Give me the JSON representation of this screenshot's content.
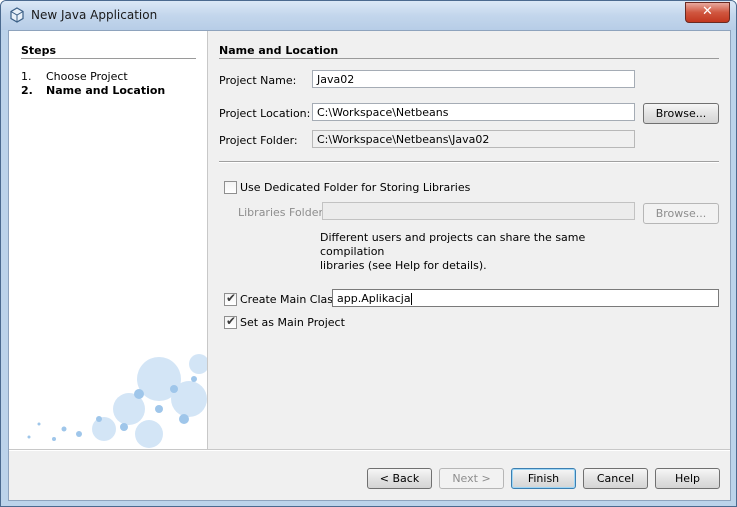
{
  "window": {
    "title": "New Java Application",
    "close_label": "✕"
  },
  "steps": {
    "title": "Steps",
    "items": [
      {
        "num": "1.",
        "label": "Choose Project",
        "active": false
      },
      {
        "num": "2.",
        "label": "Name and Location",
        "active": true
      }
    ]
  },
  "panel": {
    "title": "Name and Location",
    "project_name_label": "Project Name:",
    "project_name_value": "Java02",
    "project_location_label": "Project Location:",
    "project_location_value": "C:\\Workspace\\Netbeans",
    "browse_label": "Browse...",
    "project_folder_label": "Project Folder:",
    "project_folder_value": "C:\\Workspace\\Netbeans\\Java02",
    "dedicated_folder_label": "Use Dedicated Folder for Storing Libraries",
    "dedicated_folder_checked": false,
    "libraries_folder_label": "Libraries Folder:",
    "libraries_folder_value": "",
    "libraries_browse_label": "Browse...",
    "note_line1": "Different users and projects can share the same compilation",
    "note_line2": "libraries (see Help for details).",
    "create_main_class_label": "Create Main Class",
    "create_main_class_checked": true,
    "main_class_value": "app.Aplikacja",
    "set_main_project_label": "Set as Main Project",
    "set_main_project_checked": true
  },
  "footer": {
    "back_label": "< Back",
    "next_label": "Next >",
    "finish_label": "Finish",
    "cancel_label": "Cancel",
    "help_label": "Help"
  },
  "colors": {
    "title_bar": "#c3d6ec",
    "close_button": "#c2371f",
    "bubbles": "#9fc6ea"
  }
}
